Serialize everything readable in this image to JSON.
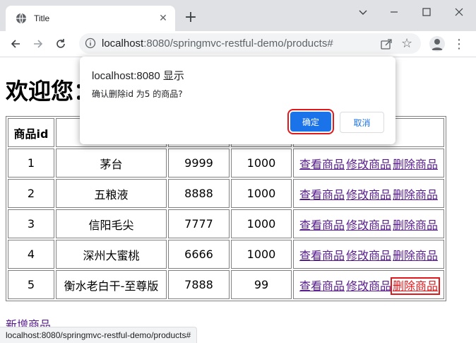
{
  "browser": {
    "tab_title": "Title",
    "url_host": "localhost",
    "url_rest": ":8080/springmvc-restful-demo/products#",
    "status_url": "localhost:8080/springmvc-restful-demo/products#",
    "icons": [
      "globe-icon",
      "close-icon",
      "plus-icon",
      "minimize-icon",
      "maximize-icon",
      "window-close-icon",
      "back-icon",
      "forward-icon",
      "reload-icon",
      "info-icon",
      "share-icon",
      "star-icon",
      "profile-icon",
      "menu-icon"
    ]
  },
  "page": {
    "heading": "欢迎您：",
    "add_link": "新增商品"
  },
  "table": {
    "headers": [
      "商品id",
      "",
      "",
      "",
      ""
    ],
    "rows": [
      {
        "id": "1",
        "name": "茅台",
        "price": "9999",
        "stock": "1000"
      },
      {
        "id": "2",
        "name": "五粮液",
        "price": "8888",
        "stock": "1000"
      },
      {
        "id": "3",
        "name": "信阳毛尖",
        "price": "7777",
        "stock": "1000"
      },
      {
        "id": "4",
        "name": "深州大蜜桃",
        "price": "6666",
        "stock": "1000"
      },
      {
        "id": "5",
        "name": "衡水老白干-至尊版",
        "price": "7888",
        "stock": "99"
      }
    ],
    "ops": {
      "view": "查看商品",
      "edit": "修改商品",
      "delete": "删除商品"
    }
  },
  "dialog": {
    "origin": "localhost:8080 显示",
    "message": "确认删除id 为5 的商品?",
    "ok": "确定",
    "cancel": "取消"
  },
  "colors": {
    "accent": "#1a73e8",
    "highlight": "#e0191c",
    "link": "#551a8b"
  }
}
